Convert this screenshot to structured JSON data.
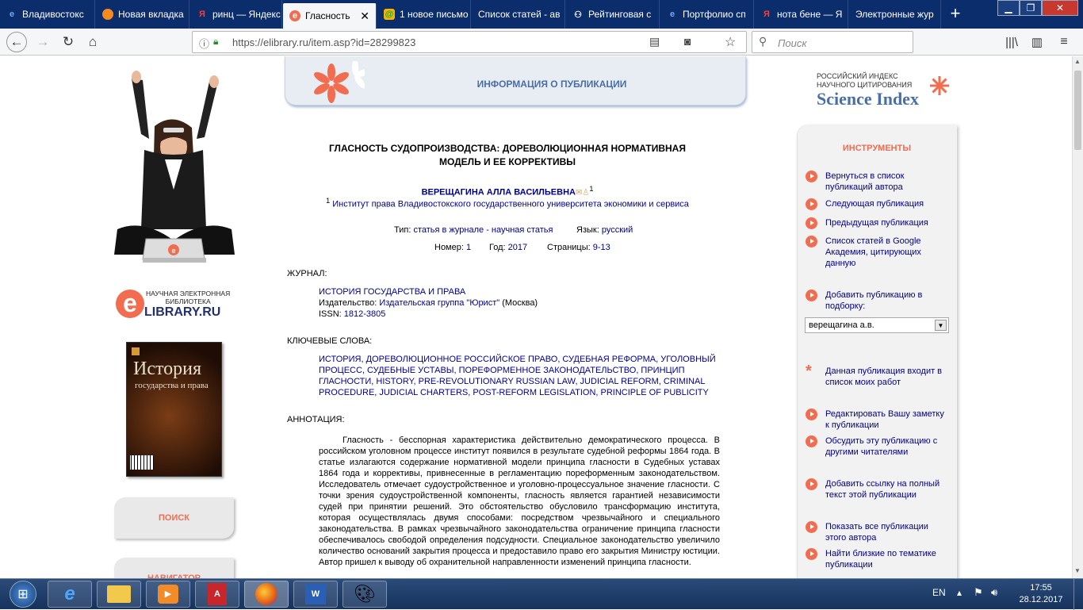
{
  "tabs": [
    {
      "label": "Владивостокс",
      "icon": "ie-icon"
    },
    {
      "label": "Новая вкладка",
      "icon": "firefox-icon"
    },
    {
      "label": "ринц — Яндекс",
      "icon": "yandex-icon"
    },
    {
      "label": "Гласность",
      "icon": "elibrary-icon",
      "active": true
    },
    {
      "label": "1 новое письмо",
      "icon": "mail-icon"
    },
    {
      "label": "Список статей - ав",
      "icon": "none"
    },
    {
      "label": "Рейтинговая с",
      "icon": "people-icon"
    },
    {
      "label": "Портфолио сп",
      "icon": "ie-icon"
    },
    {
      "label": "нота бене — Я",
      "icon": "yandex-icon"
    },
    {
      "label": "Электронные жур",
      "icon": "none"
    }
  ],
  "browser": {
    "url": "https://elibrary.ru/item.asp?id=28299823",
    "search_placeholder": "Поиск"
  },
  "header": {
    "banner_title": "ИНФОРМАЦИЯ О ПУБЛИКАЦИИ",
    "science_index_small": "РОССИЙСКИЙ ИНДЕКС\nНАУЧНОГО ЦИТИРОВАНИЯ",
    "science_index_big": "Science Index"
  },
  "sidebar": {
    "elibrary_small": "НАУЧНАЯ ЭЛЕКТРОННАЯ\nБИБЛИОТЕКА",
    "elibrary_logo": "LIBRARY.RU",
    "journal_cover_title": "История",
    "journal_cover_subtitle": "государства и права",
    "search_button": "ПОИСК",
    "navigator_button": "НАВИГАТОР"
  },
  "article": {
    "title": "ГЛАСНОСТЬ СУДОПРОИЗВОДСТВА: ДОРЕВОЛЮЦИОННАЯ НОРМАТИВНАЯ МОДЕЛЬ И ЕЕ КОРРЕКТИВЫ",
    "author": "ВЕРЕЩАГИНА АЛЛА ВАСИЛЬЕВНА",
    "author_sup": "1",
    "affiliation_sup": "1",
    "affiliation": "Институт права Владивостокского государственного университета экономики и сервиса",
    "type_label": "Тип:",
    "type_value": "статья в журнале - научная статья",
    "lang_label": "Язык:",
    "lang_value": "русский",
    "num_label": "Номер:",
    "num_value": "1",
    "year_label": "Год:",
    "year_value": "2017",
    "pages_label": "Страницы:",
    "pages_value": "9-13",
    "journal_heading": "ЖУРНАЛ:",
    "journal_name": "ИСТОРИЯ ГОСУДАРСТВА И ПРАВА",
    "publisher_label": "Издательство:",
    "publisher_value": "Издательская группа \"Юрист\"",
    "publisher_city": " (Москва)",
    "issn_label": "ISSN:",
    "issn_value": "1812-3805",
    "keywords_heading": "КЛЮЧЕВЫЕ СЛОВА:",
    "keywords": "ИСТОРИЯ, ДОРЕВОЛЮЦИОННОЕ РОССИЙСКОЕ ПРАВО, СУДЕБНАЯ РЕФОРМА, УГОЛОВНЫЙ ПРОЦЕСС, СУДЕБНЫЕ УСТАВЫ, ПОРЕФОРМЕННОЕ ЗАКОНОДАТЕЛЬСТВО, ПРИНЦИП ГЛАСНОСТИ, HISTORY, PRE-REVOLUTIONARY RUSSIAN LAW, JUDICIAL REFORM, CRIMINAL PROCEDURE, JUDICIAL CHARTERS, POST-REFORM LEGISLATION, PRINCIPLE OF PUBLICITY",
    "annotation_heading": "АННОТАЦИЯ:",
    "annotation": "Гласность - бесспорная характеристика действительно демократического процесса. В российском уголовном процессе институт появился в результате судебной реформы 1864 года. В статье излагаются содержание нормативной модели принципа гласности в Судебных уставах 1864 года и коррективы, привнесенные в регламентацию пореформенным законодательством. Исследователь отмечает судоустройственное и уголовно-процессуальное значение гласности. С точки зрения судоустройственной компоненты, гласность является гарантией независимости судей при принятии решений. Это обстоятельство обусловило трансформацию института, которая осуществлялась двумя способами: посредством чрезвычайного и специального законодательства. В рамках чрезвычайного законодательства ограничение принципа гласности обеспечивалось свободой определения подсудности. Специальное законодательство увеличило количество оснований закрытия процесса и предоставило право его закрытия Министру юстиции. Автор пришел к выводу об охранительной направленности изменений принципа гласности."
  },
  "tools": {
    "heading": "ИНСТРУМЕНТЫ",
    "items": [
      "Вернуться в список публикаций автора",
      "Следующая публикация",
      "Предыдущая публикация",
      "Список статей в Google Академия, цитирующих данную",
      "Добавить публикацию в подборку:",
      "Данная публикация входит в список моих работ",
      "Редактировать Вашу заметку к публикации",
      "Обсудить эту публикацию с другими читателями",
      "Добавить ссылку на полный текст этой публикации",
      "Показать все публикации этого автора",
      "Найти близкие по тематике публикации"
    ],
    "select_value": "верещагина а.в."
  },
  "taskbar": {
    "lang": "EN",
    "time": "17:55",
    "date": "28.12.2017"
  },
  "colors": {
    "accent": "#f26c4f",
    "link": "#00008f",
    "tabbar": "#0c2d6b",
    "banner": "#e8edf3",
    "banner_title": "#4a6ea8"
  }
}
